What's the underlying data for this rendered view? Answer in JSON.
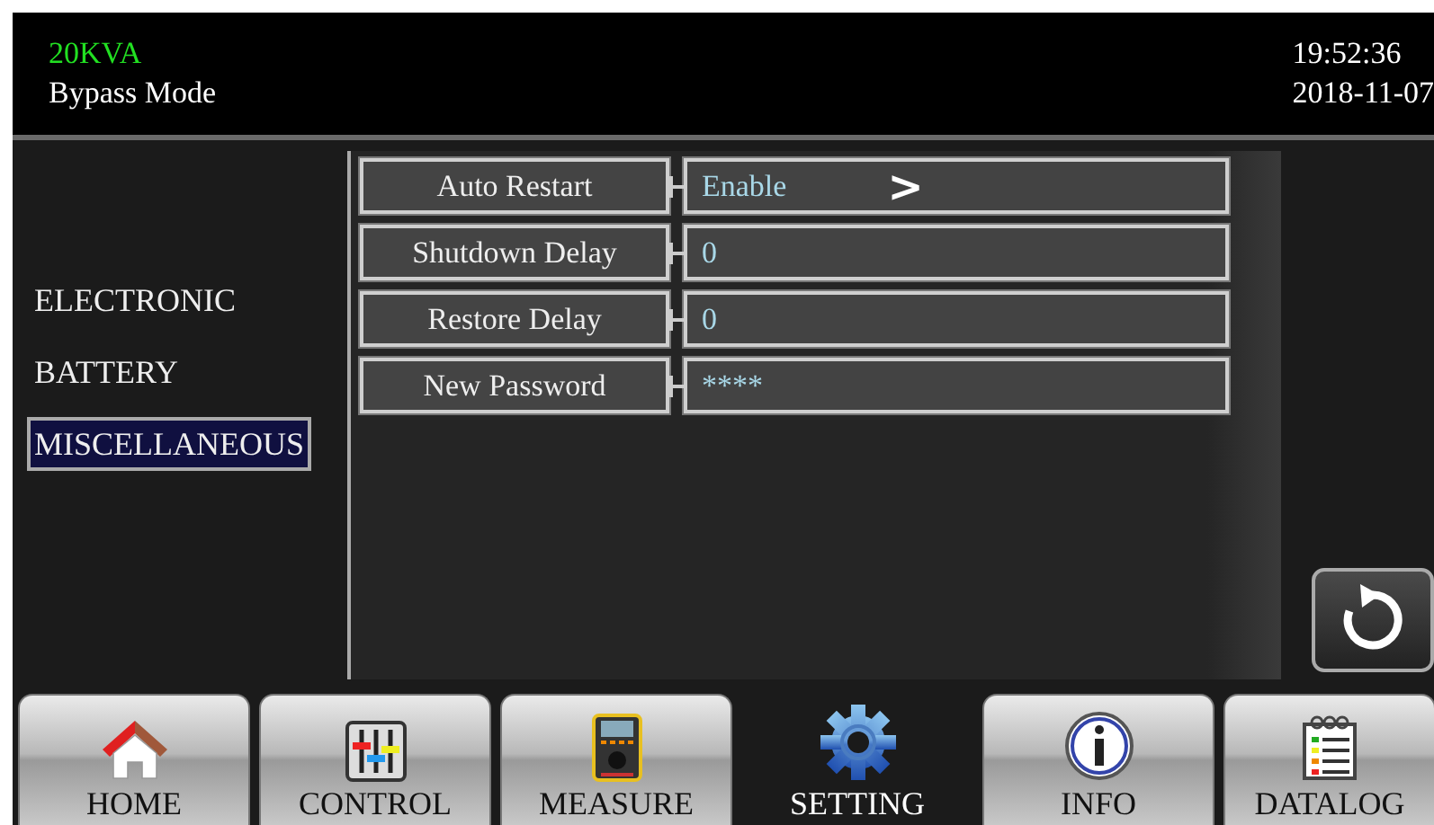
{
  "header": {
    "model": "20KVA",
    "mode": "Bypass Mode",
    "time": "19:52:36",
    "date": "2018-11-07"
  },
  "sidebar": {
    "items": [
      {
        "label": "ELECTRONIC",
        "selected": false
      },
      {
        "label": "BATTERY",
        "selected": false
      },
      {
        "label": "MISCELLANEOUS",
        "selected": true
      }
    ]
  },
  "settings": [
    {
      "label": "Auto Restart",
      "value": "Enable",
      "arrow": ">"
    },
    {
      "label": "Shutdown Delay",
      "value": "0"
    },
    {
      "label": "Restore Delay",
      "value": "0"
    },
    {
      "label": "New Password",
      "value": "****"
    }
  ],
  "tabs": [
    {
      "label": "HOME",
      "kind": "home",
      "selected": false
    },
    {
      "label": "CONTROL",
      "kind": "control",
      "selected": false
    },
    {
      "label": "MEASURE",
      "kind": "measure",
      "selected": false
    },
    {
      "label": "SETTING",
      "kind": "setting",
      "selected": true
    },
    {
      "label": "INFO",
      "kind": "info",
      "selected": false
    },
    {
      "label": "DATALOG",
      "kind": "datalog",
      "selected": false
    }
  ]
}
